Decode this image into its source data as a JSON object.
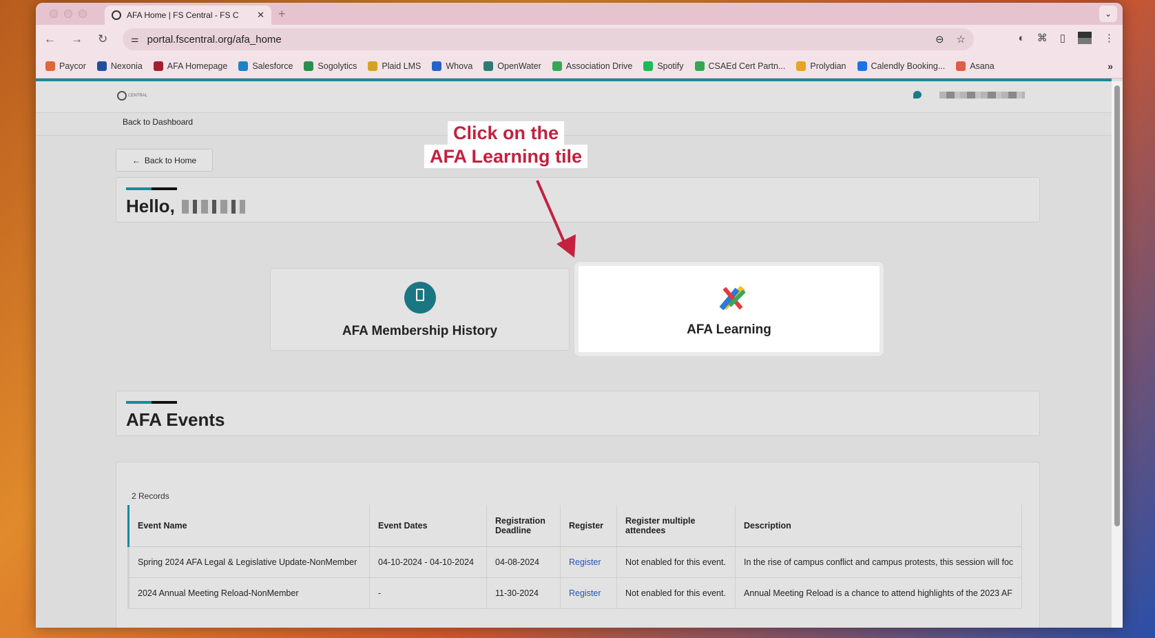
{
  "browser": {
    "tab_title": "AFA Home | FS Central - FS C",
    "url": "portal.fscentral.org/afa_home",
    "bookmarks": [
      {
        "label": "Paycor",
        "color": "#e0663a"
      },
      {
        "label": "Nexonia",
        "color": "#1e4f9c"
      },
      {
        "label": "AFA Homepage",
        "color": "#a31f30"
      },
      {
        "label": "Salesforce",
        "color": "#1d82c6"
      },
      {
        "label": "Sogolytics",
        "color": "#2a8f4e"
      },
      {
        "label": "Plaid LMS",
        "color": "#d4a324"
      },
      {
        "label": "Whova",
        "color": "#2563c9"
      },
      {
        "label": "OpenWater",
        "color": "#2e7b74"
      },
      {
        "label": "Association Drive",
        "color": "#34a853"
      },
      {
        "label": "Spotify",
        "color": "#1db954"
      },
      {
        "label": "CSAEd Cert Partn...",
        "color": "#34a853"
      },
      {
        "label": "Prolydian",
        "color": "#e6a324"
      },
      {
        "label": "Calendly Booking...",
        "color": "#1a73e8"
      },
      {
        "label": "Asana",
        "color": "#e25b49"
      }
    ]
  },
  "header": {
    "logo_text": "CENTRAL",
    "back_to_dashboard": "Back to Dashboard"
  },
  "page": {
    "back_to_home": "Back to Home",
    "greeting": "Hello,",
    "tiles": [
      {
        "label": "AFA Membership History",
        "icon": "membership-icon"
      },
      {
        "label": "AFA Learning",
        "icon": "pencils-icon"
      }
    ],
    "callout_line1": "Click on the",
    "callout_line2": "AFA Learning tile",
    "events_title": "AFA Events",
    "records_count": "2 Records",
    "table": {
      "headers": [
        "Event Name",
        "Event Dates",
        "Registration Deadline",
        "Register",
        "Register multiple attendees",
        "Description"
      ],
      "rows": [
        [
          "Spring 2024 AFA Legal & Legislative Update-NonMember",
          "04-10-2024 - 04-10-2024",
          "04-08-2024",
          "Register",
          "Not enabled for this event.",
          "In the rise of campus conflict and campus protests, this session will foc"
        ],
        [
          "2024 Annual Meeting Reload-NonMember",
          "-",
          "11-30-2024",
          "Register",
          "Not enabled for this event.",
          "Annual Meeting Reload is a chance to attend highlights of the 2023 AF"
        ]
      ]
    }
  }
}
